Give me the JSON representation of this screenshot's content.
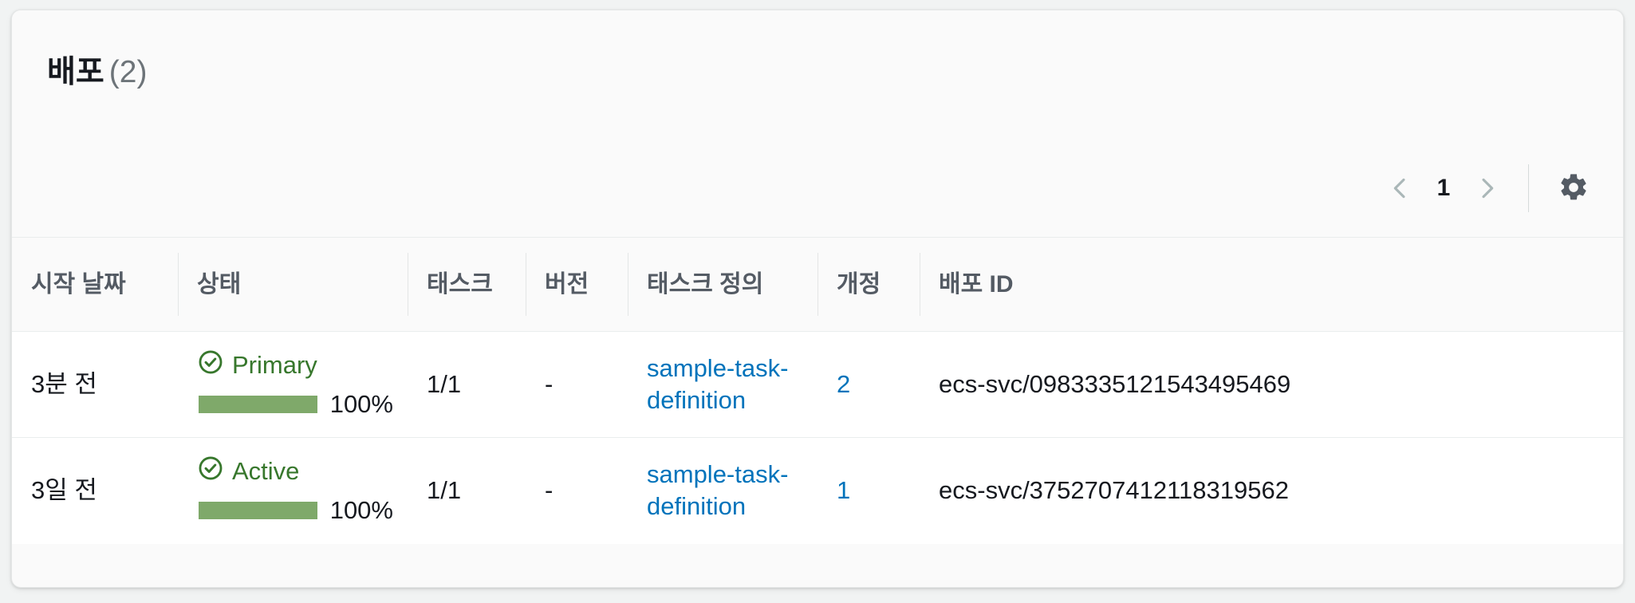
{
  "card": {
    "title": "배포",
    "count": "(2)"
  },
  "toolbar": {
    "prev_page_label": "이전 페이지",
    "current_page": "1",
    "next_page_label": "다음 페이지",
    "preferences_label": "기본 설정",
    "icons": {
      "prev": "chevron-left-icon",
      "next": "chevron-right-icon",
      "preferences": "gear-icon"
    }
  },
  "table": {
    "columns": [
      {
        "key": "start_date",
        "label": "시작 날짜"
      },
      {
        "key": "status",
        "label": "상태"
      },
      {
        "key": "tasks",
        "label": "태스크"
      },
      {
        "key": "version",
        "label": "버전"
      },
      {
        "key": "task_definition",
        "label": "태스크 정의"
      },
      {
        "key": "revision",
        "label": "개정"
      },
      {
        "key": "deployment_id",
        "label": "배포 ID"
      }
    ],
    "rows": [
      {
        "start_date": "3분 전",
        "status_label": "Primary",
        "status_icon": "status-positive-icon",
        "progress_percent": 100,
        "progress_label": "100%",
        "tasks": "1/1",
        "version": "-",
        "task_definition": "sample-task-definition",
        "revision": "2",
        "deployment_id": "ecs-svc/0983335121543495469"
      },
      {
        "start_date": "3일 전",
        "status_label": "Active",
        "status_icon": "status-positive-icon",
        "progress_percent": 100,
        "progress_label": "100%",
        "tasks": "1/1",
        "version": "-",
        "task_definition": "sample-task-definition",
        "revision": "1",
        "deployment_id": "ecs-svc/3752707412118319562"
      }
    ]
  },
  "colors": {
    "link": "#0073bb",
    "status_green": "#37772c",
    "progress_green": "#7fa96a",
    "page_background": "#f1f3f3",
    "card_background": "#fafafa",
    "row_background": "#ffffff"
  }
}
